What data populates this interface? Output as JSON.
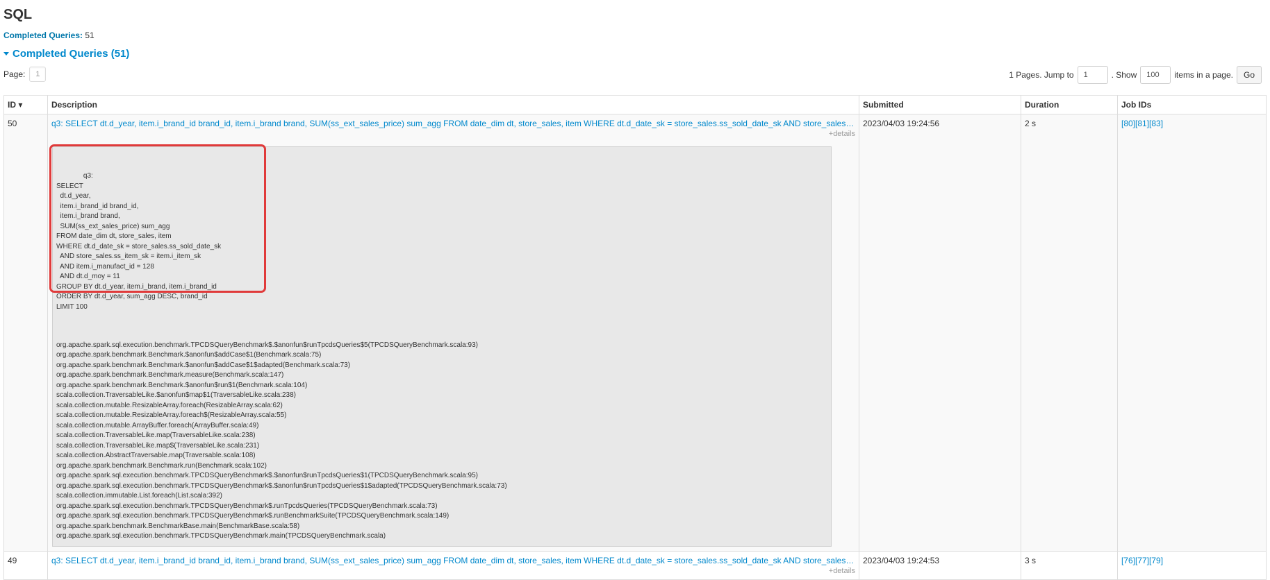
{
  "title": "SQL",
  "summary": {
    "label": "Completed Queries:",
    "count": "51"
  },
  "section": {
    "label": "Completed Queries (51)"
  },
  "pager": {
    "page_label": "Page:",
    "page_value": "1",
    "pages_text": "1 Pages. Jump to",
    "jump_value": "1",
    "show_text": ". Show",
    "show_value": "100",
    "items_text": "items in a page.",
    "go_label": "Go"
  },
  "table": {
    "headers": {
      "id": "ID ▾",
      "description": "Description",
      "submitted": "Submitted",
      "duration": "Duration",
      "jobs": "Job IDs"
    },
    "rows": [
      {
        "id": "50",
        "description": "q3: SELECT dt.d_year, item.i_brand_id brand_id, item.i_brand brand, SUM(ss_ext_sales_price) sum_agg FROM date_dim dt, store_sales, item WHERE dt.d_date_sk = store_sales.ss_sold_date_sk AND store_sales.ss_item_sk…",
        "details_label": "+details",
        "sql": "q3:\nSELECT\n  dt.d_year,\n  item.i_brand_id brand_id,\n  item.i_brand brand,\n  SUM(ss_ext_sales_price) sum_agg\nFROM date_dim dt, store_sales, item\nWHERE dt.d_date_sk = store_sales.ss_sold_date_sk\n  AND store_sales.ss_item_sk = item.i_item_sk\n  AND item.i_manufact_id = 128\n  AND dt.d_moy = 11\nGROUP BY dt.d_year, item.i_brand, item.i_brand_id\nORDER BY dt.d_year, sum_agg DESC, brand_id\nLIMIT 100",
        "stack": "org.apache.spark.sql.execution.benchmark.TPCDSQueryBenchmark$.$anonfun$runTpcdsQueries$5(TPCDSQueryBenchmark.scala:93)\norg.apache.spark.benchmark.Benchmark.$anonfun$addCase$1(Benchmark.scala:75)\norg.apache.spark.benchmark.Benchmark.$anonfun$addCase$1$adapted(Benchmark.scala:73)\norg.apache.spark.benchmark.Benchmark.measure(Benchmark.scala:147)\norg.apache.spark.benchmark.Benchmark.$anonfun$run$1(Benchmark.scala:104)\nscala.collection.TraversableLike.$anonfun$map$1(TraversableLike.scala:238)\nscala.collection.mutable.ResizableArray.foreach(ResizableArray.scala:62)\nscala.collection.mutable.ResizableArray.foreach$(ResizableArray.scala:55)\nscala.collection.mutable.ArrayBuffer.foreach(ArrayBuffer.scala:49)\nscala.collection.TraversableLike.map(TraversableLike.scala:238)\nscala.collection.TraversableLike.map$(TraversableLike.scala:231)\nscala.collection.AbstractTraversable.map(Traversable.scala:108)\norg.apache.spark.benchmark.Benchmark.run(Benchmark.scala:102)\norg.apache.spark.sql.execution.benchmark.TPCDSQueryBenchmark$.$anonfun$runTpcdsQueries$1(TPCDSQueryBenchmark.scala:95)\norg.apache.spark.sql.execution.benchmark.TPCDSQueryBenchmark$.$anonfun$runTpcdsQueries$1$adapted(TPCDSQueryBenchmark.scala:73)\nscala.collection.immutable.List.foreach(List.scala:392)\norg.apache.spark.sql.execution.benchmark.TPCDSQueryBenchmark$.runTpcdsQueries(TPCDSQueryBenchmark.scala:73)\norg.apache.spark.sql.execution.benchmark.TPCDSQueryBenchmark$.runBenchmarkSuite(TPCDSQueryBenchmark.scala:149)\norg.apache.spark.benchmark.BenchmarkBase.main(BenchmarkBase.scala:58)\norg.apache.spark.sql.execution.benchmark.TPCDSQueryBenchmark.main(TPCDSQueryBenchmark.scala)",
        "submitted": "2023/04/03 19:24:56",
        "duration": "2 s",
        "jobs": [
          "[80]",
          "[81]",
          "[83]"
        ]
      },
      {
        "id": "49",
        "description": "q3: SELECT dt.d_year, item.i_brand_id brand_id, item.i_brand brand, SUM(ss_ext_sales_price) sum_agg FROM date_dim dt, store_sales, item WHERE dt.d_date_sk = store_sales.ss_sold_date_sk AND store_sales.ss_item_sk…",
        "details_label": "+details",
        "submitted": "2023/04/03 19:24:53",
        "duration": "3 s",
        "jobs": [
          "[76]",
          "[77]",
          "[79]"
        ]
      }
    ]
  },
  "colors": {
    "link": "#0088cc",
    "highlight": "#e03a3a",
    "detail_bg": "#e8e8e8"
  }
}
